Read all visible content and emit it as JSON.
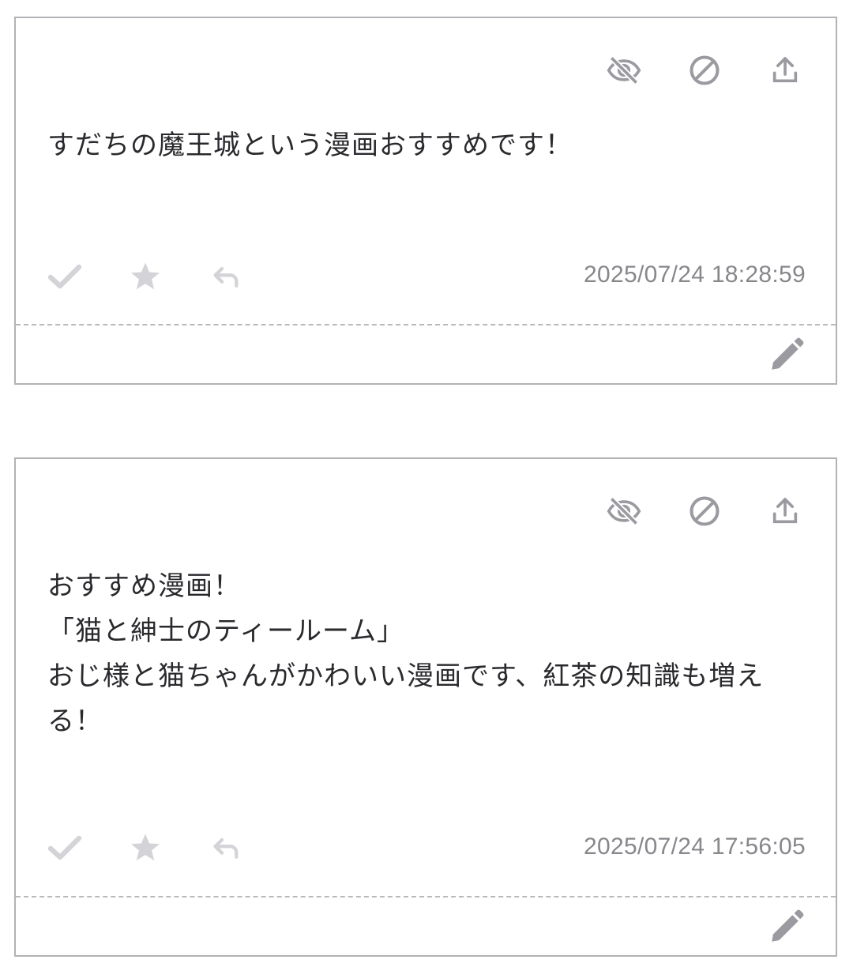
{
  "posts": [
    {
      "message": "すだちの魔王城という漫画おすすめです！",
      "timestamp": "2025/07/24 18:28:59"
    },
    {
      "message": "おすすめ漫画！\n「猫と紳士のティールーム」\nおじ様と猫ちゃんがかわいい漫画です、紅茶の知識も増える！",
      "timestamp": "2025/07/24 17:56:05"
    }
  ],
  "icons": {
    "top": [
      "eye-slash-icon",
      "block-icon",
      "upload-icon"
    ],
    "bottom": [
      "check-icon",
      "star-icon",
      "reply-icon"
    ],
    "edit": "pencil-icon"
  },
  "colors": {
    "icon_gray": "#9a9aa0",
    "icon_light": "#d4d4d8",
    "text": "#2a2a2e",
    "timestamp": "#87878c",
    "border": "#b2b2b6"
  }
}
